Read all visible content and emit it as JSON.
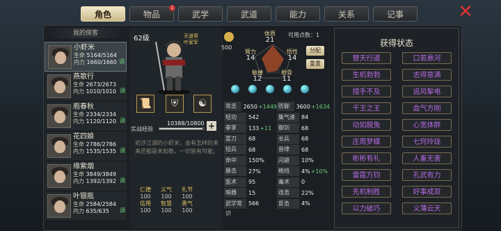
{
  "tabs": [
    {
      "label": "角色",
      "active": true
    },
    {
      "label": "物品",
      "badge": "1"
    },
    {
      "label": "武学"
    },
    {
      "label": "武道"
    },
    {
      "label": "能力"
    },
    {
      "label": "关系"
    },
    {
      "label": "记事"
    }
  ],
  "list_title": "我的侠客",
  "characters": [
    {
      "name": "小虾米",
      "hp_label": "生命",
      "hp": "5164/5164",
      "mp_label": "内力",
      "mp": "1660/1660",
      "tag": "调",
      "selected": true
    },
    {
      "name": "燕歌行",
      "hp_label": "生命",
      "hp": "2673/2673",
      "mp_label": "内力",
      "mp": "1010/1010",
      "tag": "调"
    },
    {
      "name": "庖春秋",
      "hp_label": "生命",
      "hp": "2334/2334",
      "mp_label": "内力",
      "mp": "1120/1120",
      "tag": "调"
    },
    {
      "name": "花四娘",
      "hp_label": "生命",
      "hp": "2786/2786",
      "mp_label": "内力",
      "mp": "1535/1535",
      "tag": "调"
    },
    {
      "name": "缘紫烟",
      "hp_label": "生命",
      "hp": "3849/3849",
      "mp_label": "内力",
      "mp": "1392/1392",
      "tag": "调"
    },
    {
      "name": "叶银瓶",
      "hp_label": "生命",
      "hp": "2584/2584",
      "mp_label": "内力",
      "mp": "635/635",
      "tag": "调"
    }
  ],
  "hero": {
    "level": "62级",
    "faction": [
      "天道帮",
      "叶家军"
    ],
    "exp_label": "实战经验",
    "exp": "10388/10800",
    "exp_ratio": 0.962,
    "desc": "初涉江湖的小虾米，会有怎样的未来还都是未知数，一切皆有可能。",
    "virtues": [
      {
        "k": "仁德",
        "v": "100"
      },
      {
        "k": "义气",
        "v": "100"
      },
      {
        "k": "礼节",
        "v": "100"
      },
      {
        "k": "",
        "v": ""
      },
      {
        "k": "信用",
        "v": "100"
      },
      {
        "k": "智慧",
        "v": "100"
      },
      {
        "k": "勇气",
        "v": "100"
      },
      {
        "k": "",
        "v": ""
      }
    ]
  },
  "potential": "500",
  "points_label": "可用点数：1",
  "btn_assign": "分配",
  "btn_reset": "重置",
  "radar": {
    "tizhi_l": "体质",
    "tizhi": "21",
    "bili_l": "臂力",
    "bili": "14",
    "wuxing_l": "悟性",
    "wuxing": "14",
    "minjie_l": "敏捷",
    "minjie": "12",
    "gengu_l": "根骨",
    "gengu": "11"
  },
  "stats": [
    {
      "l": "攻击力",
      "v": "2650",
      "p": "+1449"
    },
    {
      "l": "防御力",
      "v": "3600",
      "p": "+1634"
    },
    {
      "l": "轻功",
      "v": "542",
      "p": ""
    },
    {
      "l": "集气速度",
      "v": "84",
      "p": ""
    },
    {
      "l": "拳掌",
      "v": "133",
      "p": "+11"
    },
    {
      "l": "御剑",
      "v": "68",
      "p": ""
    },
    {
      "l": "耍刀",
      "v": "68",
      "p": ""
    },
    {
      "l": "长兵",
      "v": "68",
      "p": ""
    },
    {
      "l": "短兵",
      "v": "68",
      "p": ""
    },
    {
      "l": "音律",
      "v": "68",
      "p": ""
    },
    {
      "l": "命中",
      "v": "150%",
      "p": ""
    },
    {
      "l": "闪避",
      "v": "10%",
      "p": ""
    },
    {
      "l": "暴击",
      "v": "27%",
      "p": ""
    },
    {
      "l": "格挡",
      "v": "4%",
      "p": "+10%"
    },
    {
      "l": "医术",
      "v": "95",
      "p": ""
    },
    {
      "l": "毒术",
      "v": "0",
      "p": ""
    },
    {
      "l": "暗器",
      "v": "15",
      "p": ""
    },
    {
      "l": "连击",
      "v": "22%",
      "p": ""
    },
    {
      "l": "武学常识",
      "v": "566",
      "p": ""
    },
    {
      "l": "反击",
      "v": "4%",
      "p": ""
    }
  ],
  "states_title": "获得状态",
  "states": [
    "替天行道",
    "口若悬河",
    "生机勃勃",
    "志得意满",
    "措手不及",
    "追风掣电",
    "千王之王",
    "血气方刚",
    "动如脱兔",
    "心宽体胖",
    "庄周梦蝶",
    "七窍玲珑",
    "彬彬有礼",
    "人畜无害",
    "雷霆万钧",
    "孔武有力",
    "先机制胜",
    "好事成双",
    "以力破巧",
    "义薄云天"
  ]
}
